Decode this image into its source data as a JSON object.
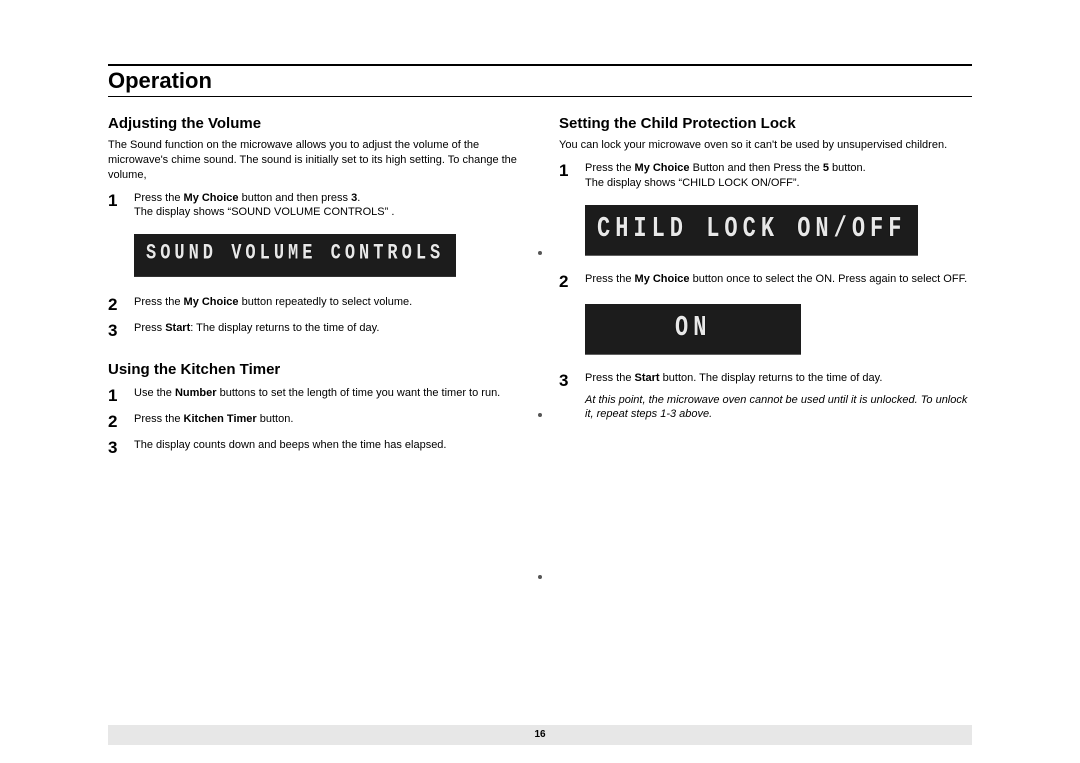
{
  "pageTitle": "Operation",
  "pageNumber": "16",
  "left": {
    "vol": {
      "heading": "Adjusting the Volume",
      "intro_a": "The Sound function on the microwave allows you to adjust the volume of the microwave's chime sound. The sound is initially set to its high set",
      "intro_b": "ting. To change the volume,",
      "steps": {
        "s1n": "1",
        "s1_a": "Press the ",
        "s1_b": "My Choice",
        "s1_c": " button and then press ",
        "s1_d": "3",
        "s1_e": ".",
        "s1_f": "The display shows “SOUND VOLUME CONTROLS” .",
        "lcd1": "SOUND VOLUME CONTROLS",
        "s2n": "2",
        "s2_a": "Press the ",
        "s2_b": "My Choice",
        "s2_c": " button repeatedly to select volume.",
        "s3n": "3",
        "s3_a": "Press ",
        "s3_b": "Start",
        "s3_c": ": The display returns to the time of day."
      }
    },
    "timer": {
      "heading": "Using the Kitchen Timer",
      "steps": {
        "s1n": "1",
        "s1_a": "Use the ",
        "s1_b": "Number",
        "s1_c": " buttons to set the length of time you want the timer to run.",
        "s2n": "2",
        "s2_a": "Press the ",
        "s2_b": "Kitchen Timer",
        "s2_c": " button.",
        "s3n": "3",
        "s3_a": "The display counts down and beeps when the time has elapsed."
      }
    }
  },
  "right": {
    "lock": {
      "heading": "Setting the Child Protection Lock",
      "intro": "You can lock your microwave oven so it can't be used by unsupervised children.",
      "steps": {
        "s1n": "1",
        "s1_a": "Press the ",
        "s1_b": "My Choice",
        "s1_c": " Button and then Press the ",
        "s1_d": "5",
        "s1_e": " button.",
        "s1_f": "The display shows “CHILD LOCK ON/OFF”.",
        "lcd1": "CHILD LOCK ON/OFF",
        "s2n": "2",
        "s2_a": "Press the ",
        "s2_b": "My Choice",
        "s2_c": " button once to select the ON. Press again to select OFF.",
        "lcd2": "ON",
        "s3n": "3",
        "s3_a": "Press the ",
        "s3_b": "Start ",
        "s3_c": " button. The display returns to the time of day."
      },
      "note": "At this point, the microwave oven cannot be used until it is unlocked. To unlock it, repeat steps 1-3 above."
    }
  }
}
